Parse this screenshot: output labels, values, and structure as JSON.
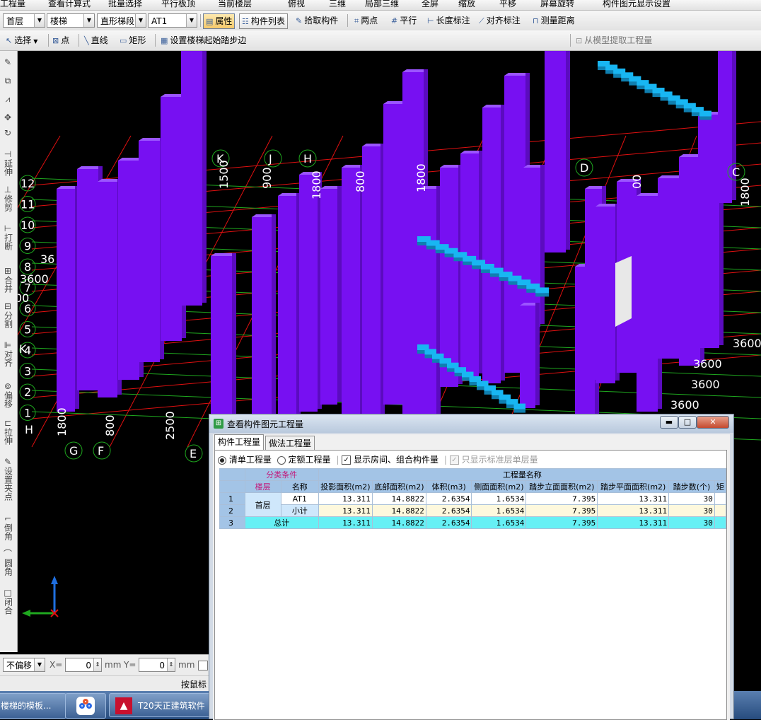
{
  "top_menu": {
    "items": [
      "工程量",
      "查看计算式",
      "批量选择",
      "平行板顶",
      "当前楼层",
      "俯视",
      "三维",
      "局部三维",
      "全屏",
      "缩放",
      "平移",
      "屏幕旋转",
      "构件图元显示设置"
    ]
  },
  "toolbar1": {
    "floor": "首层",
    "category": "楼梯",
    "subtype": "直形梯段",
    "component": "AT1",
    "attributes": "属性",
    "component_list": "构件列表",
    "pick_component": "拾取构件",
    "two_points": "两点",
    "parallel": "平行",
    "length_mark": "长度标注",
    "align_mark": "对齐标注",
    "measure": "测量距离"
  },
  "toolbar2": {
    "select": "选择",
    "point": "点",
    "line": "直线",
    "rect": "矩形",
    "set_stair_edge": "设置楼梯起始踏步边",
    "extract": "从模型提取工程量"
  },
  "left_tools": [
    "延伸",
    "修剪",
    "打断",
    "合并",
    "分割",
    "对齐",
    "偏移",
    "拉伸",
    "设置夹点",
    "倒角",
    "圆角",
    "闭合"
  ],
  "viewport": {
    "axis_labels_top": [
      "K",
      "J",
      "H",
      "D",
      "C"
    ],
    "axis_labels_left": [
      "12",
      "11",
      "10",
      "9",
      "8",
      "7",
      "6",
      "5",
      "4",
      "3",
      "2",
      "1"
    ],
    "axis_labels_bottom": [
      "G",
      "F",
      "E"
    ],
    "left_letters": [
      "K",
      "H"
    ],
    "dims_vertical": [
      "1500",
      "900",
      "1800",
      "1800",
      "800",
      "2500",
      "1800"
    ],
    "dims_partial": [
      "36",
      "3600",
      "00",
      "800",
      "1800",
      "00"
    ],
    "dims_right": [
      "3600",
      "3600",
      "3600",
      "3600"
    ],
    "colors": {
      "column": "#7710f2",
      "stair": "#18b6f2",
      "grid_red": "#e01010",
      "grid_green": "#1fa81f"
    }
  },
  "status": {
    "offset_mode": "不偏移",
    "x_label": "X=",
    "x_value": "0",
    "unit": "mm",
    "y_label": "Y=",
    "y_value": "0",
    "hint": "按鼠标"
  },
  "taskbar": {
    "items": [
      "楼梯的模板...",
      "",
      "T20天正建筑软件"
    ]
  },
  "dialog": {
    "title": "查看构件图元工程量",
    "tabs": [
      "构件工程量",
      "做法工程量"
    ],
    "options": {
      "qty_list": "清单工程量",
      "qty_quota": "定额工程量",
      "show_room": "显示房间、组合构件量",
      "std_floor_only": "只显示标准层单层量"
    },
    "header": {
      "group_label": "分类条件",
      "qty_label": "工程量名称",
      "floor": "楼层",
      "name": "名称",
      "columns": [
        "投影面积(m2)",
        "底部面积(m2)",
        "体积(m3)",
        "侧面面积(m2)",
        "踏步立面面积(m2)",
        "踏步平面面积(m2)",
        "踏步数(个)",
        "矩"
      ]
    },
    "rows": [
      {
        "no": "1",
        "floor": "首层",
        "name": "AT1",
        "values": [
          "13.311",
          "14.8822",
          "2.6354",
          "1.6534",
          "7.395",
          "13.311",
          "30"
        ]
      },
      {
        "no": "2",
        "floor": "",
        "name": "小计",
        "values": [
          "13.311",
          "14.8822",
          "2.6354",
          "1.6534",
          "7.395",
          "13.311",
          "30"
        ]
      },
      {
        "no": "3",
        "floor": "",
        "name": "总计",
        "values": [
          "13.311",
          "14.8822",
          "2.6354",
          "1.6534",
          "7.395",
          "13.311",
          "30"
        ]
      }
    ]
  }
}
